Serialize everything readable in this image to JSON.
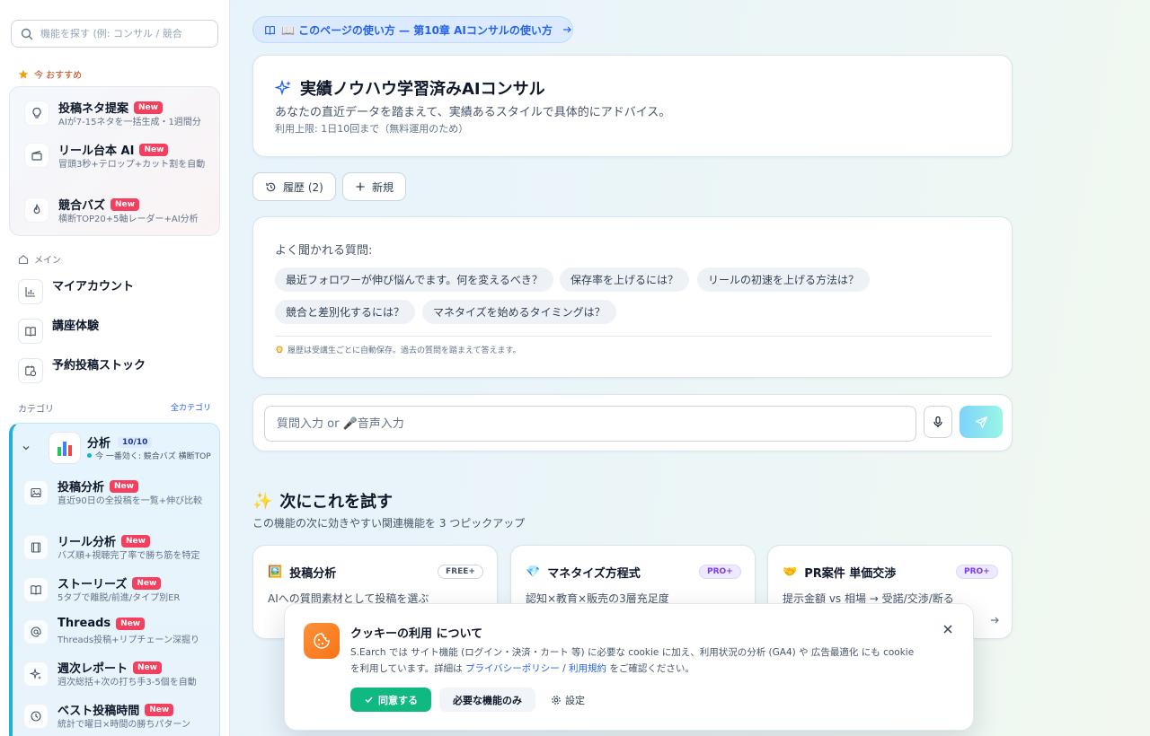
{
  "sidebar": {
    "search_placeholder": "機能を探す (例: コンサル / 競合",
    "recommended_label": "今 おすすめ",
    "recommended": [
      {
        "title": "投稿ネタ提案",
        "badge": "New",
        "desc": "AIが7-15ネタを一括生成・1週間分"
      },
      {
        "title": "リール台本 AI",
        "badge": "New",
        "desc": "冒頭3秒+テロップ+カット割を自動"
      },
      {
        "title": "競合バズ",
        "badge": "New",
        "desc": "横断TOP20+5軸レーダー+AI分析"
      }
    ],
    "main_label": "メイン",
    "main": [
      {
        "label": "マイアカウント"
      },
      {
        "label": "講座体験"
      },
      {
        "label": "予約投稿ストック"
      }
    ],
    "category_label": "カテゴリ",
    "all_categories": "全カテゴリ",
    "category": {
      "title": "分析",
      "count": "10/10",
      "sub": "今 一番効く: 競合バズ 横断TOP",
      "items": [
        {
          "title": "投稿分析",
          "badge": "New",
          "desc": "直近90日の全投稿を一覧+伸び比較"
        },
        {
          "title": "リール分析",
          "badge": "New",
          "desc": "バズ順+視聴完了率で勝ち筋を特定"
        },
        {
          "title": "ストーリーズ",
          "badge": "New",
          "desc": "5タブで離脱/前進/タイプ別ER"
        },
        {
          "title": "Threads",
          "badge": "New",
          "desc": "Threads投稿+リプチェーン深掘り"
        },
        {
          "title": "週次レポート",
          "badge": "New",
          "desc": "週次総括+次の打ち手3-5個を自動"
        },
        {
          "title": "ベスト投稿時間",
          "badge": "New",
          "desc": "統計で曜日×時間の勝ちパターン"
        }
      ]
    }
  },
  "main": {
    "howto_label": "📖 このページの使い方 — 第10章 AIコンサルの使い方",
    "hero": {
      "title": "実績ノウハウ学習済みAIコンサル",
      "desc": "あなたの直近データを踏まえて、実績あるスタイルで具体的にアドバイス。",
      "limit": "利用上限: 1日10回まで（無料運用のため）"
    },
    "history_label": "履歴 (2)",
    "new_label": "新規",
    "faq": {
      "title": "よく聞かれる質問:",
      "chips": [
        "最近フォロワーが伸び悩んでます。何を変えるべき？",
        "保存率を上げるには？",
        "リールの初速を上げる方法は？",
        "競合と差別化するには？",
        "マネタイズを始めるタイミングは？"
      ],
      "note": "履歴は受講生ごとに自動保存。過去の質問を踏まえて答えます。"
    },
    "input_placeholder": "質問入力 or 🎤音声入力",
    "next": {
      "title": "次にこれを試す",
      "subtitle": "この機能の次に効きやすい関連機能を 3 つピックアップ",
      "cards": [
        {
          "icon": "🖼️",
          "title": "投稿分析",
          "tier": "FREE+",
          "desc": "AIへの質問素材として投稿を選ぶ"
        },
        {
          "icon": "💎",
          "title": "マネタイズ方程式",
          "tier": "PRO+",
          "desc": "認知×教育×販売の3層充足度"
        },
        {
          "icon": "🤝",
          "title": "PR案件 単価交渉",
          "tier": "PRO+",
          "desc": "提示金額 vs 相場 → 受諾/交渉/断る"
        }
      ]
    }
  },
  "cookie": {
    "title": "クッキーの利用 について",
    "text_1": "S.Earch では サイト機能 (ログイン・決済・カート 等) に必要な cookie に加え、利用状況の分析 (GA4) や 広告最適化 にも cookie を利用しています。詳細は ",
    "privacy_link": "プライバシーポリシー",
    "sep": " / ",
    "terms_link": "利用規約",
    "text_2": " をご確認ください。",
    "agree_label": "同意する",
    "needed_label": "必要な機能のみ",
    "settings_label": "設定"
  },
  "colors": {
    "accent": "#2563eb",
    "new_badge": "#f43f5e",
    "agree": "#10b981",
    "cookie_icon": "#f97316"
  }
}
